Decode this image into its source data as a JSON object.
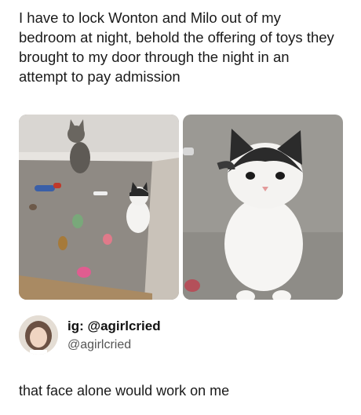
{
  "post": {
    "caption": "I have to lock Wonton and Milo out of my bedroom at night, behold the offering of toys they brought to my door through the night in an attempt to pay admission"
  },
  "photos": [
    {
      "icon": "cat-with-toys-photo"
    },
    {
      "icon": "cat-closeup-photo"
    }
  ],
  "author": {
    "avatar_icon": "profile-avatar",
    "display_name": "ig: @agirlcried",
    "handle": "@agirlcried"
  },
  "reply": {
    "text": "that face alone would work on me"
  }
}
